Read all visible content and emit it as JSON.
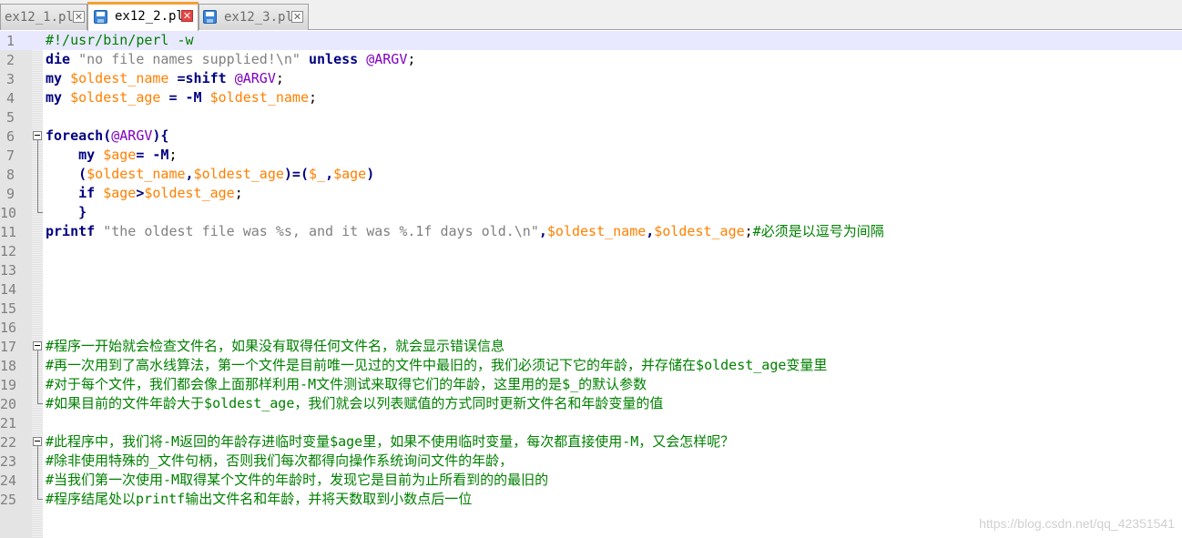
{
  "tabs": [
    {
      "label": "ex12_1.pl",
      "active": false,
      "icon": "none"
    },
    {
      "label": "ex12_2.pl",
      "active": true,
      "icon": "floppy-disk-icon"
    },
    {
      "label": "ex12_3.pl",
      "active": false,
      "icon": "floppy-disk-icon"
    }
  ],
  "close_glyph": "✕",
  "line_numbers": [
    "1",
    "2",
    "3",
    "4",
    "5",
    "6",
    "7",
    "8",
    "9",
    "10",
    "11",
    "12",
    "13",
    "14",
    "15",
    "16",
    "17",
    "18",
    "19",
    "20",
    "21",
    "22",
    "23",
    "24",
    "25"
  ],
  "code": {
    "l1": {
      "text": "#!/usr/bin/perl -w"
    },
    "l2": {
      "die": "die",
      "str": " \"no file names supplied!\\n\" ",
      "unless": "unless",
      "argv": " @ARGV",
      "semi": ";"
    },
    "l3": {
      "my": "my",
      "var": " $oldest_name ",
      "op": "=shift",
      "argv": " @ARGV",
      "semi": ";"
    },
    "l4": {
      "my": "my",
      "var": " $oldest_age ",
      "op": "= -M",
      "var2": " $oldest_name",
      "semi": ";"
    },
    "l6": {
      "kw": "foreach",
      "p1": "(",
      "argv": "@ARGV",
      "p2": "){"
    },
    "l7": {
      "indent": "    ",
      "my": "my",
      "var": " $age",
      "op": "= -M",
      "semi": ";"
    },
    "l8": {
      "indent": "    ",
      "p1": "(",
      "v1": "$oldest_name",
      "c1": ",",
      "v2": "$oldest_age",
      "p2": ")=(",
      "v3": "$_",
      "c2": ",",
      "v4": "$age",
      "p3": ")"
    },
    "l9": {
      "indent": "    ",
      "kw": "if",
      "v1": " $age",
      "op": ">",
      "v2": "$oldest_age",
      "semi": ";"
    },
    "l10": {
      "indent": "    ",
      "brace": "}"
    },
    "l11": {
      "kw": "printf",
      "str": " \"the oldest file was %s, and it was %.1f days old.\\n\"",
      "c1": ",",
      "v1": "$oldest_name",
      "c2": ",",
      "v2": "$oldest_age",
      "semi": ";",
      "cm": "#必须是以逗号为间隔"
    },
    "l17": "#程序一开始就会检查文件名，如果没有取得任何文件名，就会显示错误信息",
    "l18": "#再一次用到了高水线算法，第一个文件是目前唯一见过的文件中最旧的，我们必须记下它的年龄，并存储在$oldest_age变量里",
    "l19": "#对于每个文件，我们都会像上面那样利用-M文件测试来取得它们的年龄，这里用的是$_的默认参数",
    "l20": "#如果目前的文件年龄大于$oldest_age，我们就会以列表赋值的方式同时更新文件名和年龄变量的值",
    "l22": "#此程序中，我们将-M返回的年龄存进临时变量$age里，如果不使用临时变量，每次都直接使用-M，又会怎样呢？",
    "l23": "#除非使用特殊的_文件句柄，否则我们每次都得向操作系统询问文件的年龄，",
    "l24": "#当我们第一次使用-M取得某个文件的年龄时，发现它是目前为止所看到的的最旧的",
    "l25": "#程序结尾处以printf输出文件名和年龄，并将天数取到小数点后一位"
  },
  "watermark": "https://blog.csdn.net/qq_42351541",
  "colors": {
    "keyword": "#000080",
    "string": "#808080",
    "scalar": "#ff8000",
    "array": "#8000c0",
    "comment": "#008000",
    "current_line": "#e8e8ff",
    "active_tab_accent": "#f5a032"
  }
}
